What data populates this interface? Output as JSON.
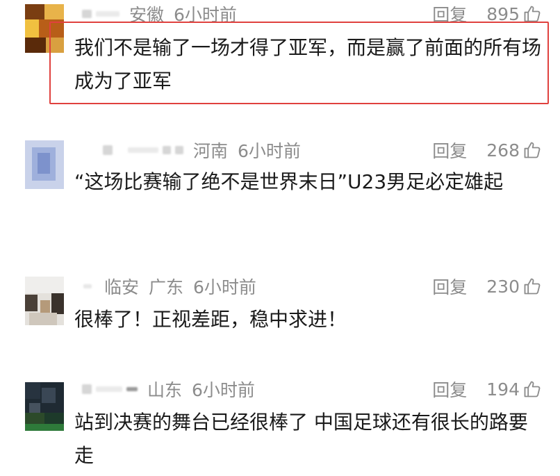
{
  "comments": [
    {
      "location": "安徽",
      "time": "6小时前",
      "reply_label": "回复",
      "likes": "895",
      "text": "我们不是输了一场才得了亚军，而是赢了前面的所有场成为了亚军",
      "highlighted": true
    },
    {
      "location": "河南",
      "time": "6小时前",
      "reply_label": "回复",
      "likes": "268",
      "text": "“这场比赛输了绝不是世界末日”U23男足必定雄起"
    },
    {
      "username": "临安",
      "location": "广东",
      "time": "6小时前",
      "reply_label": "回复",
      "likes": "230",
      "text": "很棒了！正视差距，稳中求进！"
    },
    {
      "location": "山东",
      "time": "6小时前",
      "reply_label": "回复",
      "likes": "194",
      "text": "站到决赛的舞台已经很棒了 中国足球还有很长的路要走"
    }
  ],
  "colors": {
    "highlight_border": "#e0413e",
    "meta_text": "#8c8c8c",
    "body_text": "#1a1a1a"
  },
  "icons": {
    "like": "thumbs-up-icon"
  }
}
